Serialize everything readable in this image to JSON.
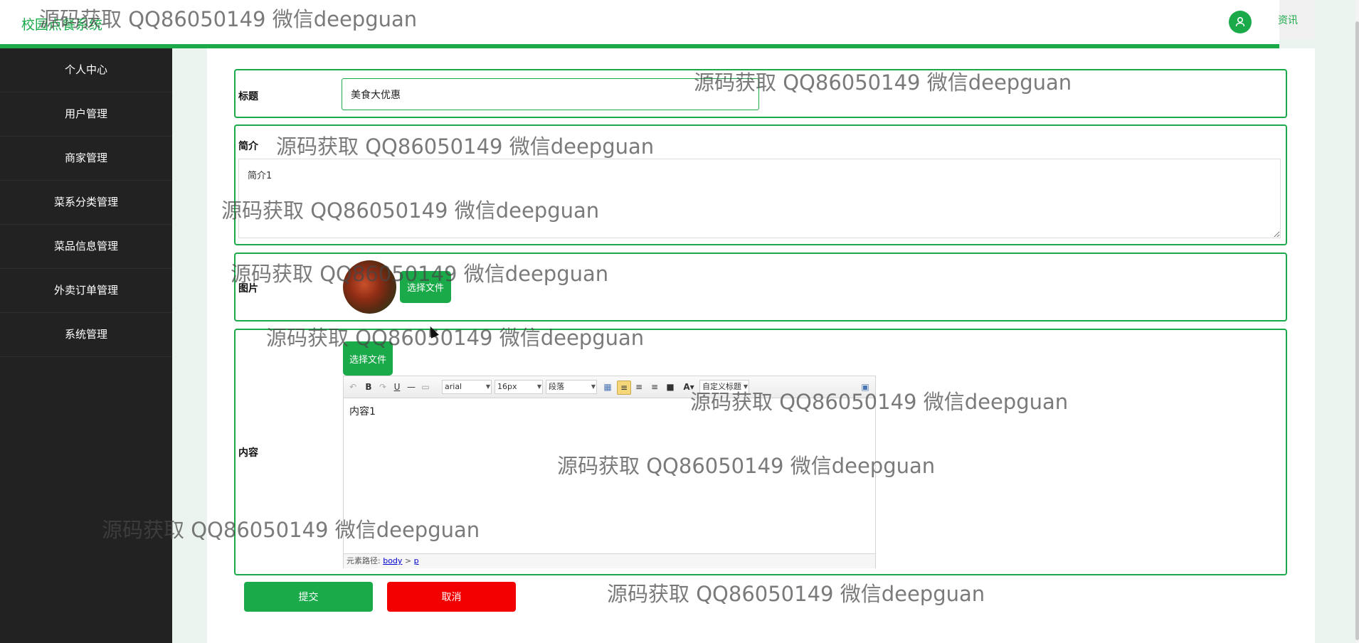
{
  "app": {
    "title": "校园点餐系统",
    "header_link": "资讯"
  },
  "sidebar": {
    "items": [
      {
        "label": "个人中心"
      },
      {
        "label": "用户管理"
      },
      {
        "label": "商家管理"
      },
      {
        "label": "菜系分类管理"
      },
      {
        "label": "菜品信息管理"
      },
      {
        "label": "外卖订单管理"
      },
      {
        "label": "系统管理"
      }
    ]
  },
  "form": {
    "title": {
      "label": "标题",
      "value": "美食大优惠"
    },
    "intro": {
      "label": "简介",
      "value": "简介1"
    },
    "image": {
      "label": "图片",
      "choose_label": "选择文件"
    },
    "content": {
      "label": "内容",
      "choose_label": "选择文件",
      "editor": {
        "font_family": "arial",
        "font_size": "16px",
        "paragraph": "段落",
        "custom_title": "自定义标题",
        "body_text": "内容1",
        "path_label": "元素路径:",
        "path_body": "body",
        "path_sep": ">",
        "path_p": "p"
      }
    }
  },
  "actions": {
    "submit_label": "提交",
    "cancel_label": "取消"
  },
  "watermarks": [
    "源码获取 QQ86050149 微信deepguan",
    "源码获取 QQ86050149 微信deepguan",
    "源码获取 QQ86050149 微信deepguan",
    "源码获取 QQ86050149 微信deepguan",
    "源码获取 QQ86050149 微信deepguan",
    "源码获取 QQ86050149 微信deepguan",
    "源码获取 QQ86050149 微信deepguan",
    "源码获取 QQ86050149 微信deepguan",
    "源码获取 QQ86050149 微信deepguan",
    "源码获取 QQ86050149 微信deepguan"
  ],
  "colors": {
    "accent": "#1aaa4a",
    "danger": "#f20000",
    "sidebar": "#222222"
  }
}
